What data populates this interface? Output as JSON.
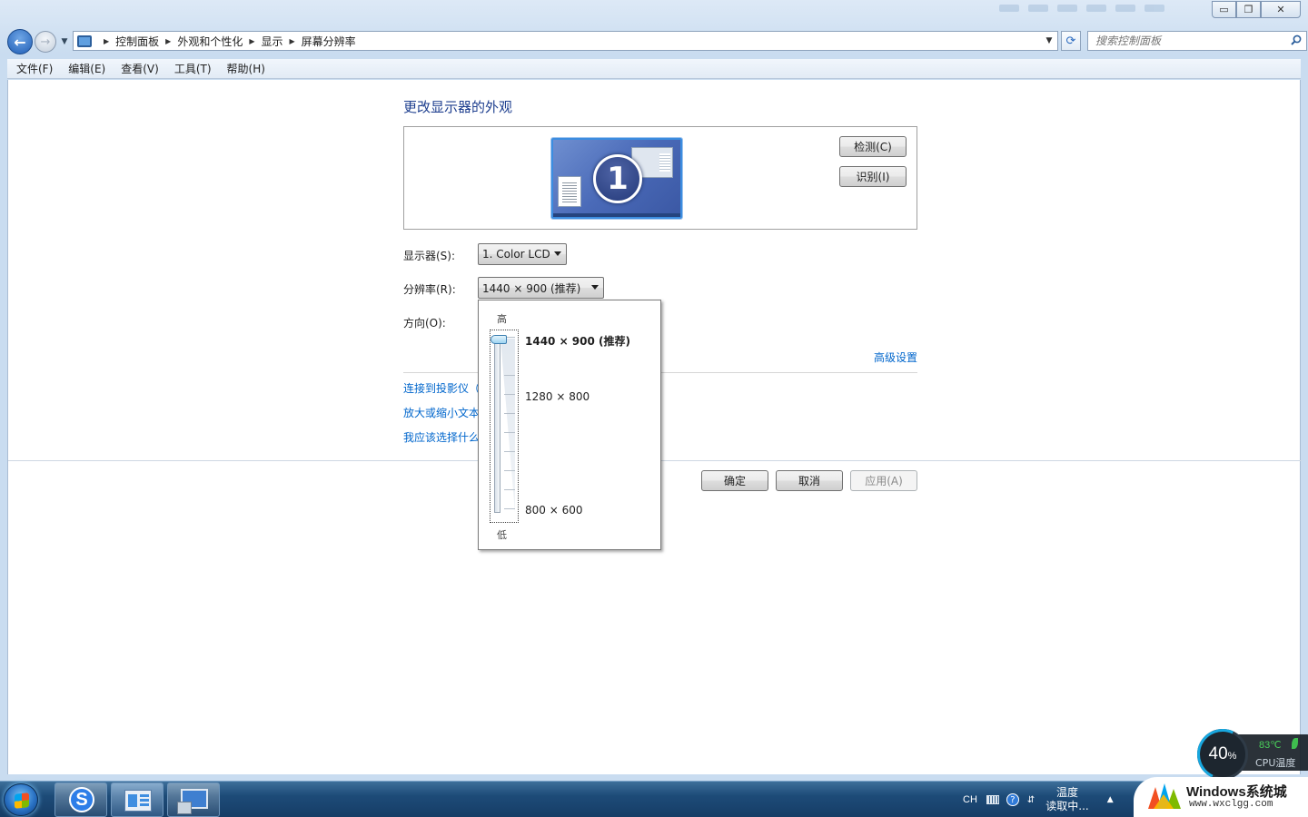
{
  "window": {
    "caption": {
      "minimize": "▭",
      "maximize": "❐",
      "close": "✕"
    }
  },
  "nav": {
    "back": "←",
    "forward": "→",
    "breadcrumb": [
      "控制面板",
      "外观和个性化",
      "显示",
      "屏幕分辨率"
    ],
    "search_placeholder": "搜索控制面板"
  },
  "menu": [
    "文件(F)",
    "编辑(E)",
    "查看(V)",
    "工具(T)",
    "帮助(H)"
  ],
  "page": {
    "title": "更改显示器的外观",
    "monitor_number": "1",
    "detect_button": "检测(C)",
    "identify_button": "识别(I)",
    "display_label": "显示器(S):",
    "display_value": "1. Color LCD",
    "resolution_label": "分辨率(R):",
    "resolution_value": "1440 × 900 (推荐)",
    "orientation_label": "方向(O):",
    "advanced_link": "高级设置",
    "links": [
      "连接到投影仪（",
      "放大或缩小文本",
      "我应该选择什么"
    ],
    "ok_button": "确定",
    "cancel_button": "取消",
    "apply_button": "应用(A)"
  },
  "resolution_popup": {
    "high_label": "高",
    "low_label": "低",
    "options": [
      "1440 × 900 (推荐)",
      "1280 × 800",
      "800 × 600"
    ],
    "selected_index": 0,
    "slider_level": 1.0
  },
  "cpu_widget": {
    "usage": "40",
    "usage_unit": "%",
    "temperature": "83℃",
    "label": "CPU温度"
  },
  "taskbar": {
    "sogou_glyph": "S",
    "lang": "CH",
    "help_glyph": "?",
    "temp_line1": "温度",
    "temp_line2": "读取中...",
    "tray_up": "▲"
  },
  "watermark": {
    "title": "Windows系统城",
    "url": "www.wxclgg.com"
  },
  "colors": {
    "link": "#0066cc",
    "title": "#1e3f8f",
    "taskbar": "#1d4b78"
  }
}
